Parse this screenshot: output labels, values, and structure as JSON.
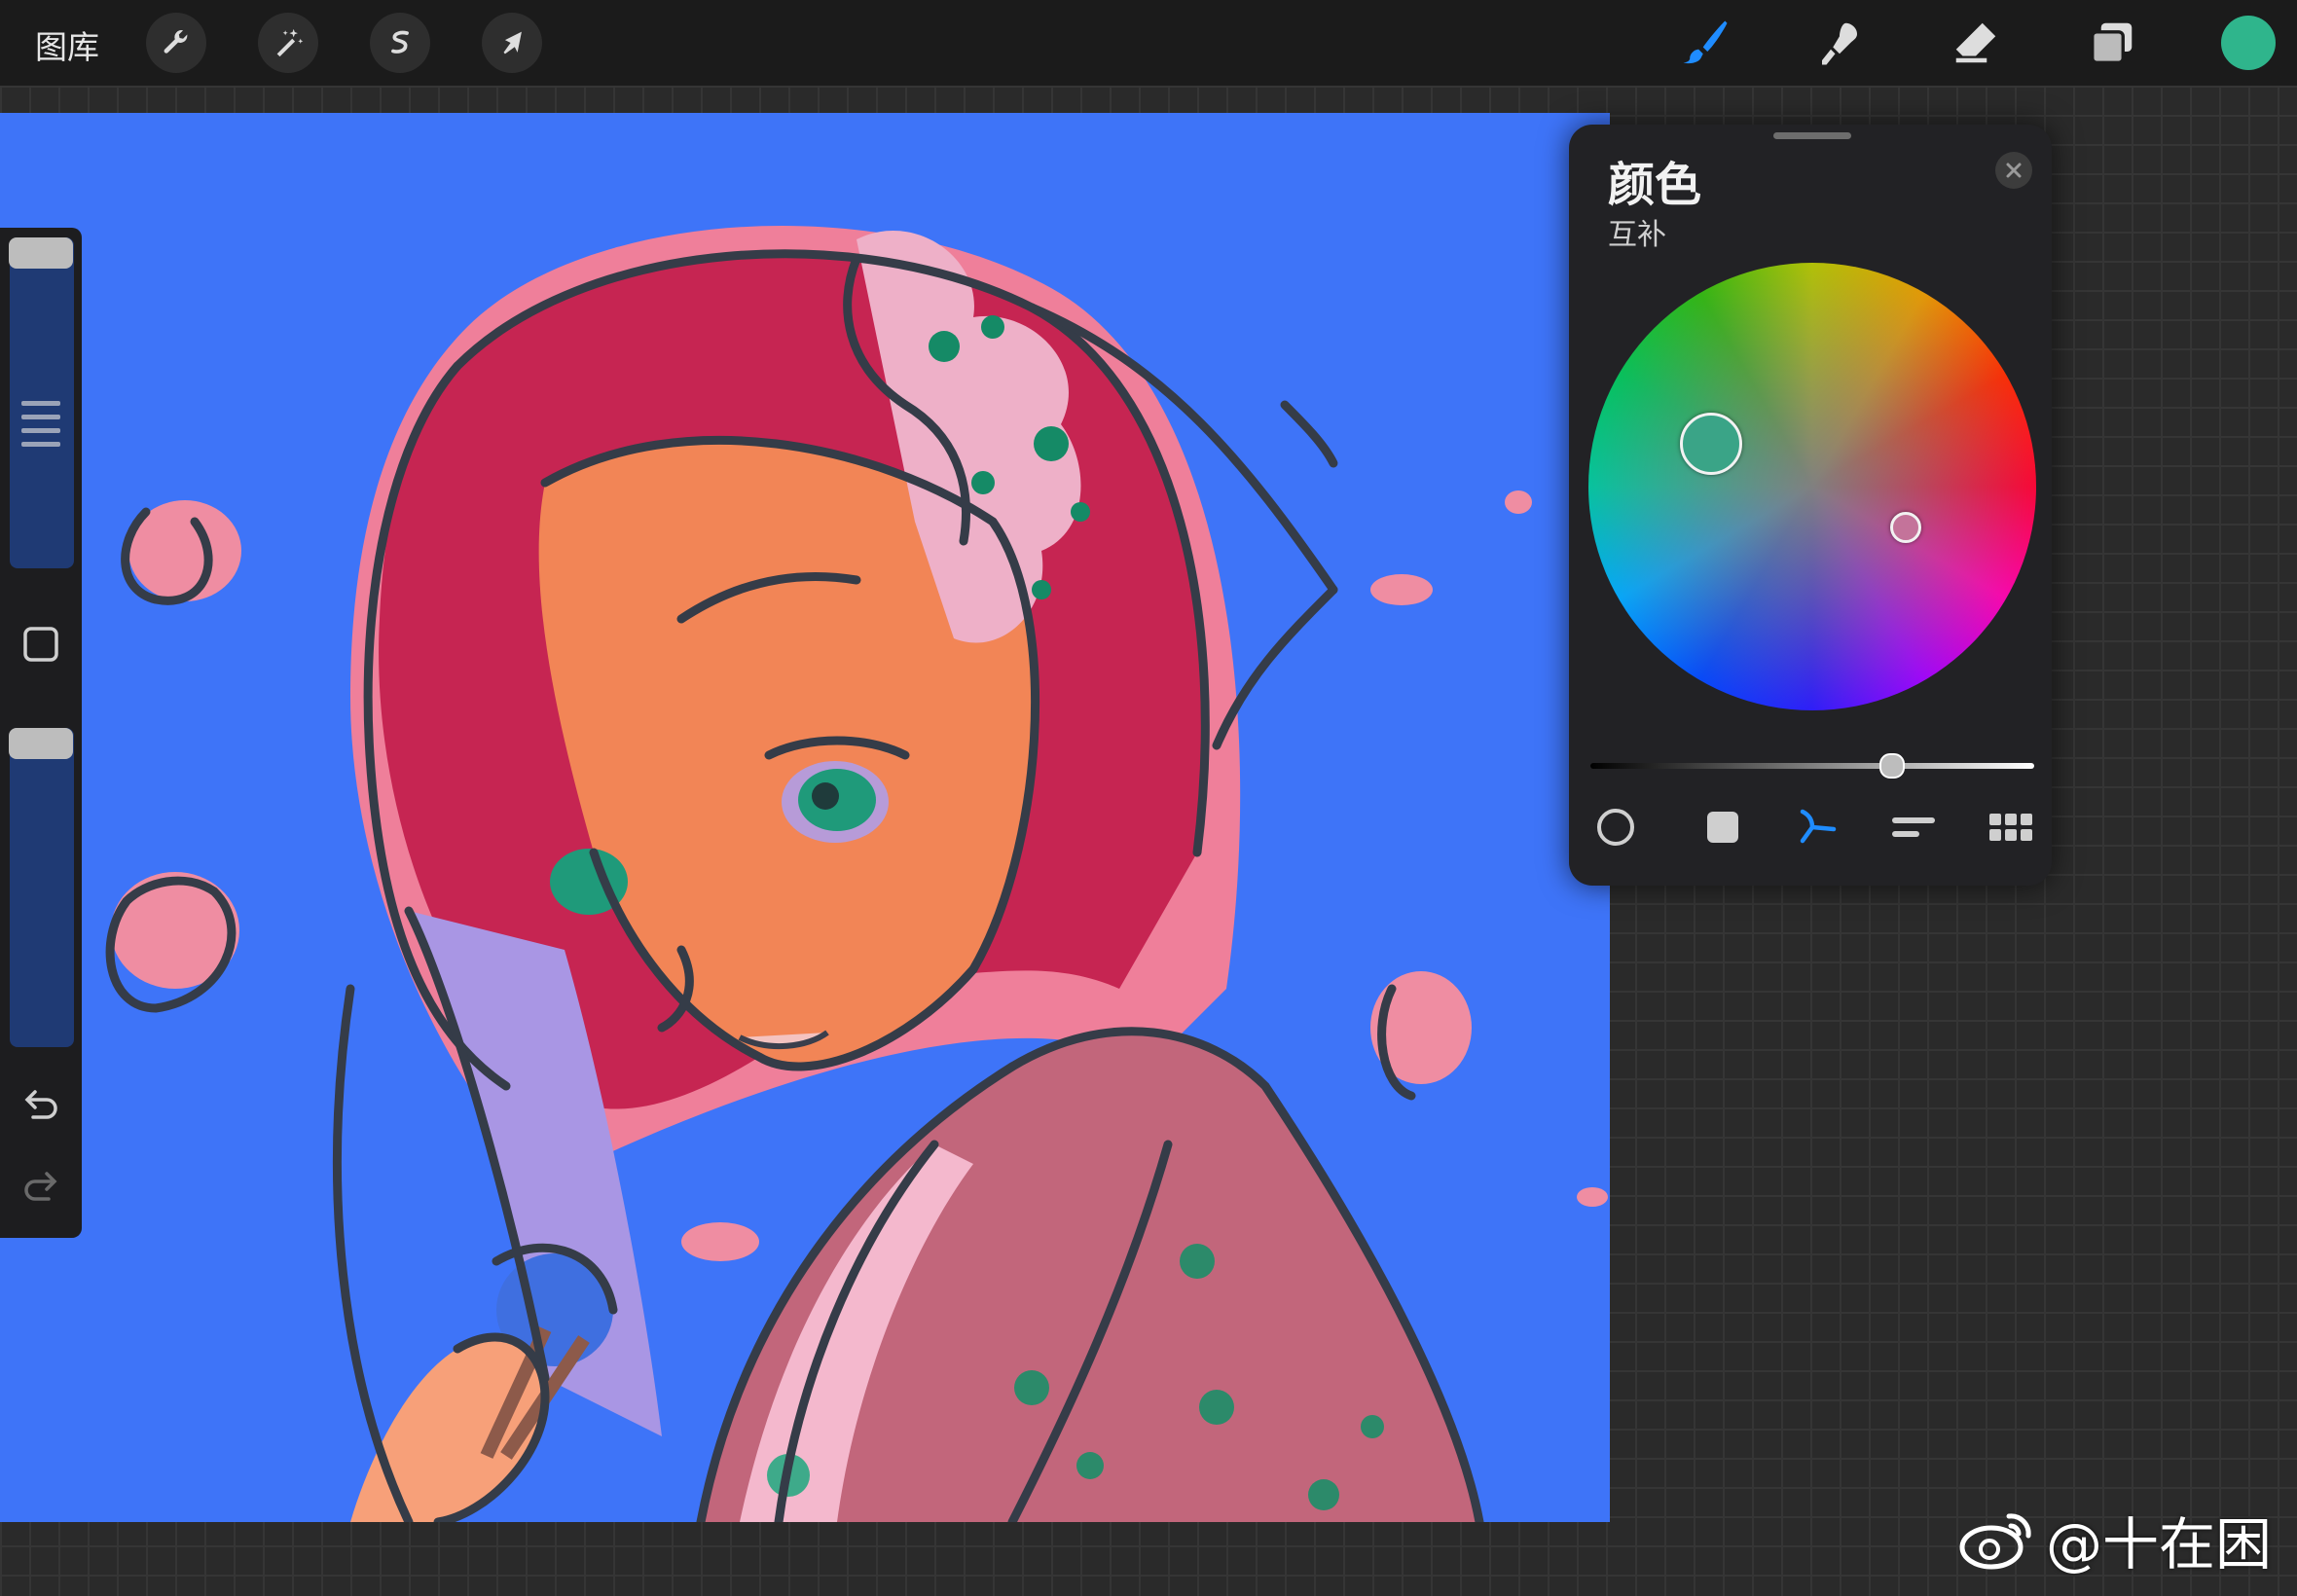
{
  "topbar": {
    "gallery_label": "图库",
    "tools_left": [
      "wrench-icon",
      "magic-wand-icon",
      "selection-icon",
      "transform-arrow-icon"
    ],
    "tools_right": [
      "brush-icon",
      "smudge-icon",
      "eraser-icon",
      "layers-icon"
    ],
    "active_tool": "brush-icon",
    "current_color": "#2fb58c"
  },
  "color_panel": {
    "title": "颜色",
    "subtitle": "互补",
    "brightness": 0.68,
    "primary_color": "#3aa487",
    "complement_color": "#c4739a",
    "modes": [
      "disc-mode-icon",
      "classic-mode-icon",
      "harmony-mode-icon",
      "value-mode-icon",
      "palettes-mode-icon"
    ],
    "active_mode": "harmony-mode-icon"
  },
  "watermark": {
    "text": "@十在困"
  },
  "colors": {
    "canvas_bg": "#3e74f8",
    "accent": "#1f8cff"
  }
}
